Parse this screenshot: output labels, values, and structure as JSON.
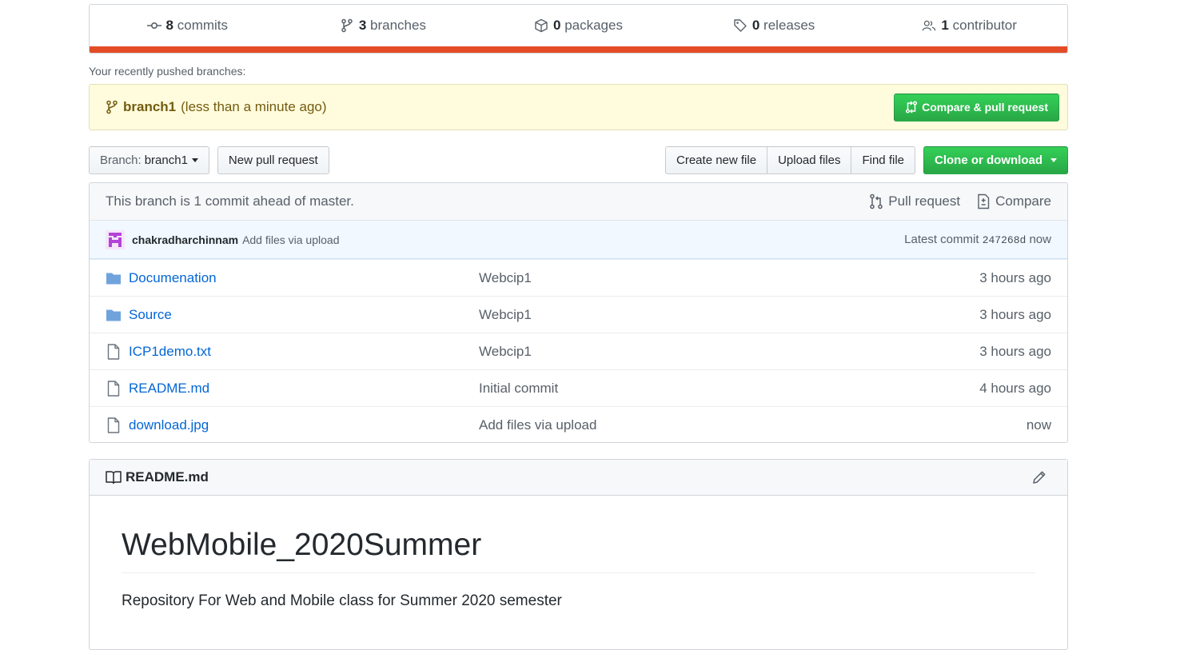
{
  "summary": {
    "commits": {
      "count": "8",
      "label": "commits"
    },
    "branches": {
      "count": "3",
      "label": "branches"
    },
    "packages": {
      "count": "0",
      "label": "packages"
    },
    "releases": {
      "count": "0",
      "label": "releases"
    },
    "contributors": {
      "count": "1",
      "label": "contributor"
    }
  },
  "recent": {
    "label": "Your recently pushed branches:",
    "branch": "branch1",
    "time": "(less than a minute ago)",
    "compare_button": "Compare & pull request"
  },
  "toolbar": {
    "branch_prefix": "Branch:",
    "branch_name": "branch1",
    "new_pr": "New pull request",
    "create_file": "Create new file",
    "upload_files": "Upload files",
    "find_file": "Find file",
    "clone": "Clone or download"
  },
  "branch_info": {
    "status": "This branch is 1 commit ahead of master.",
    "pull_request": "Pull request",
    "compare": "Compare"
  },
  "latest_commit": {
    "author": "chakradharchinnam",
    "message": "Add files via upload",
    "label": "Latest commit",
    "sha": "247268d",
    "time": "now"
  },
  "files": [
    {
      "type": "folder",
      "name": "Documenation",
      "message": "Webcip1",
      "age": "3 hours ago"
    },
    {
      "type": "folder",
      "name": "Source",
      "message": "Webcip1",
      "age": "3 hours ago"
    },
    {
      "type": "file",
      "name": "ICP1demo.txt",
      "message": "Webcip1",
      "age": "3 hours ago"
    },
    {
      "type": "file",
      "name": "README.md",
      "message": "Initial commit",
      "age": "4 hours ago"
    },
    {
      "type": "file",
      "name": "download.jpg",
      "message": "Add files via upload",
      "age": "now"
    }
  ],
  "readme": {
    "filename": "README.md",
    "title": "WebMobile_2020Summer",
    "description": "Repository For Web and Mobile class for Summer 2020 semester"
  },
  "colors": {
    "language_bar": "#e34c26",
    "link": "#0366d6",
    "green": "#28a745"
  }
}
